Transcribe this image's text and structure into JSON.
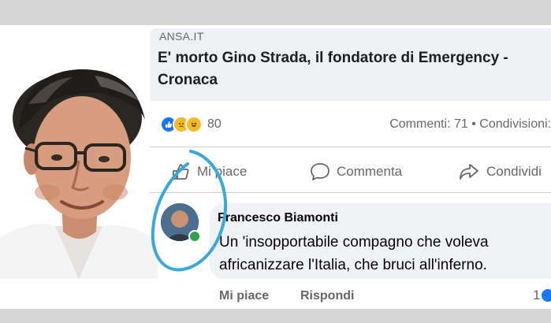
{
  "post": {
    "source": "ANSA.IT",
    "headline": "E' morto Gino Strada, il fondatore di Emergency - Cronaca",
    "reactions": {
      "icons": [
        "like-icon",
        "sad-icon",
        "haha-icon"
      ],
      "count": "80"
    },
    "stats": "Commenti: 71 • Condivisioni:"
  },
  "actions": {
    "like": "Mi piace",
    "comment": "Commenta",
    "share": "Condividi"
  },
  "comment": {
    "author": "Francesco Biamonti",
    "text_line1": "Un 'insopportabile compagno che  voleva",
    "text_line2": "africanizzare l'Italia, che bruci all'inferno.",
    "like": "Mi piace",
    "reply": "Rispondi",
    "reaction_count": "1"
  },
  "colors": {
    "accent": "#1877f2",
    "annotation_circle": "#3aa8d8",
    "text_secondary": "#65676b"
  }
}
